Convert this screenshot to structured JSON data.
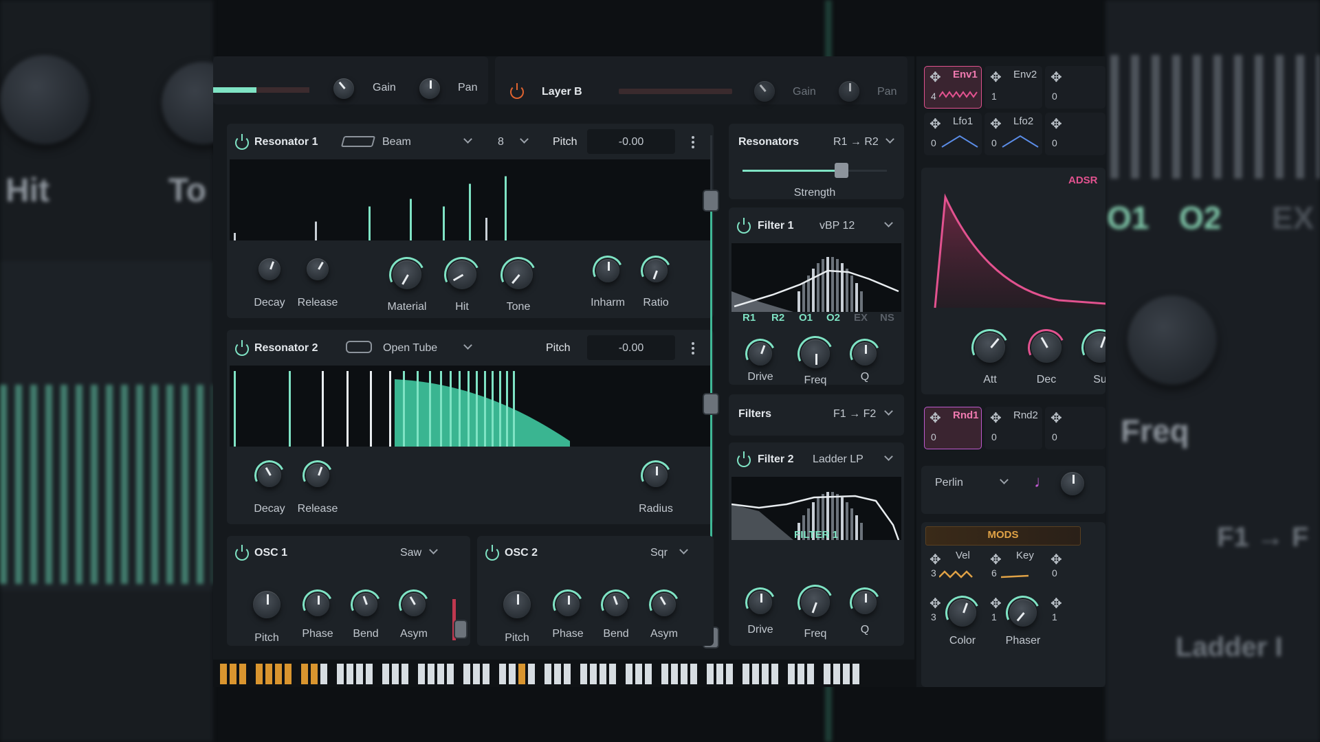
{
  "background": {
    "left_text_1": "Hit",
    "left_text_2": "To",
    "right_tabs": [
      "O1",
      "O2",
      "EX"
    ],
    "right_freq": "Freq",
    "right_route": "F1 → F",
    "right_ladder": "Ladder I"
  },
  "top": {
    "layer_a": {
      "gain_label": "Gain",
      "pan_label": "Pan"
    },
    "layer_b": {
      "name": "Layer B",
      "gain_label": "Gain",
      "pan_label": "Pan"
    }
  },
  "resonator1": {
    "title": "Resonator 1",
    "type": "Beam",
    "count": "8",
    "pitch_label": "Pitch",
    "pitch_value": "-0.00",
    "knobs": [
      "Decay",
      "Release",
      "Material",
      "Hit",
      "Tone",
      "Inharm",
      "Ratio"
    ],
    "spectrum_levels": [
      0.1,
      0.25,
      0.45,
      0.55,
      0.45,
      0.75,
      0.3,
      0.85
    ]
  },
  "resonator2": {
    "title": "Resonator 2",
    "type": "Open Tube",
    "pitch_label": "Pitch",
    "pitch_value": "-0.00",
    "knobs": [
      "Decay",
      "Release",
      "Radius"
    ]
  },
  "osc1": {
    "title": "OSC 1",
    "wave": "Saw",
    "knobs": [
      "Pitch",
      "Phase",
      "Bend",
      "Asym"
    ]
  },
  "osc2": {
    "title": "OSC 2",
    "wave": "Sqr",
    "knobs": [
      "Pitch",
      "Phase",
      "Bend",
      "Asym"
    ]
  },
  "resonators_route": {
    "label": "Resonators",
    "route": "R1 → R2",
    "strength_label": "Strength"
  },
  "filter1": {
    "title": "Filter 1",
    "type": "vBP 12",
    "tabs": [
      "R1",
      "R2",
      "O1",
      "O2",
      "EX",
      "NS"
    ],
    "knobs": [
      "Drive",
      "Freq",
      "Q"
    ]
  },
  "filters_route": {
    "label": "Filters",
    "route": "F1 → F2"
  },
  "filter2": {
    "title": "Filter 2",
    "type": "Ladder LP",
    "display_label": "FILTER 1",
    "knobs": [
      "Drive",
      "Freq",
      "Q"
    ]
  },
  "mod": {
    "slots_row1": [
      {
        "name": "Env1",
        "count": "4"
      },
      {
        "name": "Env2",
        "count": "1"
      },
      {
        "name": "",
        "count": "0"
      }
    ],
    "slots_row2": [
      {
        "name": "Lfo1",
        "count": "0"
      },
      {
        "name": "Lfo2",
        "count": "0"
      },
      {
        "name": "",
        "count": "0"
      }
    ],
    "adsr_label": "ADSR",
    "adsr_knobs": [
      "Att",
      "Dec",
      "Su"
    ],
    "slots_row3": [
      {
        "name": "Rnd1",
        "count": "0"
      },
      {
        "name": "Rnd2",
        "count": "0"
      },
      {
        "name": "",
        "count": "0"
      }
    ],
    "noise_type": "Perlin",
    "mods_label": "MODS",
    "mods_slots": [
      {
        "name": "Vel",
        "count": "3"
      },
      {
        "name": "Key",
        "count": "6"
      },
      {
        "name": "",
        "count": "0"
      }
    ],
    "mods_knobs": [
      {
        "name": "Color",
        "count": "3"
      },
      {
        "name": "Phaser",
        "count": "1"
      },
      {
        "name": "",
        "count": "1"
      }
    ]
  },
  "colors": {
    "accent": "#7fe3c4",
    "power_off": "#e0632f",
    "env": "#e2528f",
    "keys_active": "#d9952f"
  }
}
